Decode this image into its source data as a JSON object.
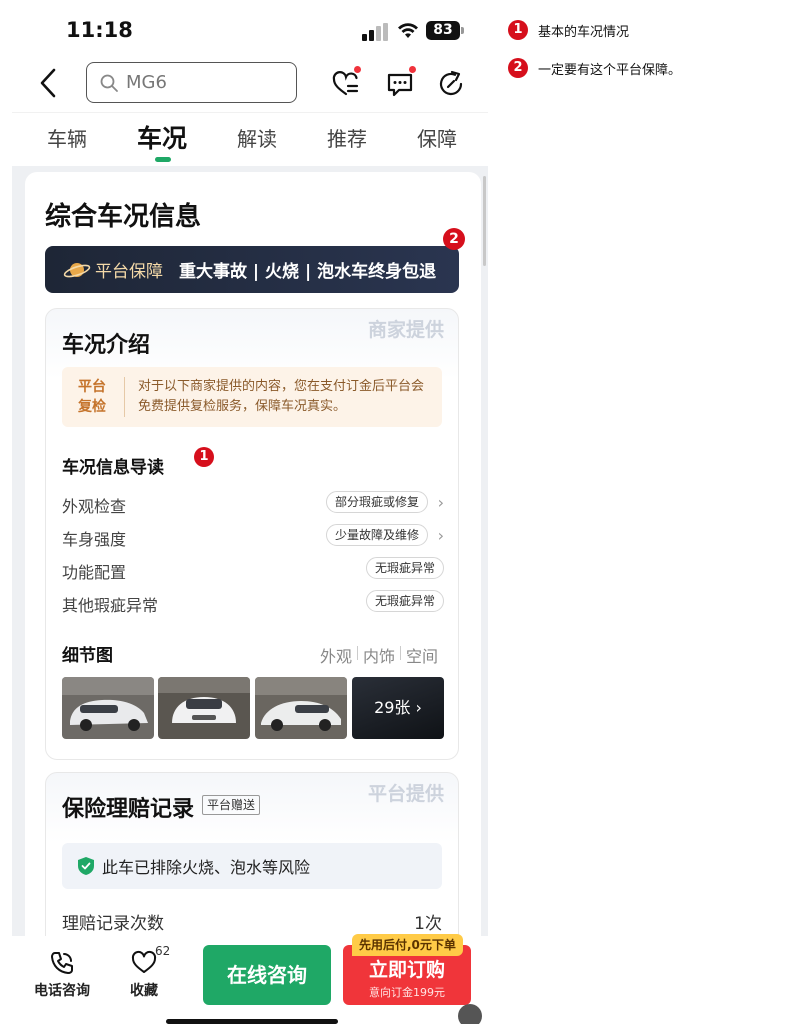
{
  "status_bar": {
    "time": "11:18",
    "battery": "83"
  },
  "nav": {
    "search_value": "MG6"
  },
  "tabs": [
    {
      "label": "车辆"
    },
    {
      "label": "车况",
      "active": true
    },
    {
      "label": "解读"
    },
    {
      "label": "推荐"
    },
    {
      "label": "保障"
    }
  ],
  "main": {
    "title": "综合车况信息",
    "banner": {
      "label": "平台保障",
      "text": "重大事故 | 火烧 | 泡水车终身包退"
    },
    "marker_2": "2",
    "intro": {
      "provider": "商家提供",
      "title": "车况介绍",
      "notice_tag": "平台复检",
      "notice_text": "对于以下商家提供的内容，您在支付订金后平台会免费提供复检服务，保障车况真实。",
      "guide_title": "车况信息导读",
      "marker_1": "1",
      "rows": [
        {
          "label": "外观检查",
          "value": "部分瑕疵或修复",
          "chevron": "›"
        },
        {
          "label": "车身强度",
          "value": "少量故障及维修",
          "chevron": "›"
        },
        {
          "label": "功能配置",
          "value": "无瑕疵异常"
        },
        {
          "label": "其他瑕疵异常",
          "value": "无瑕疵异常"
        }
      ],
      "detail_title": "细节图",
      "detail_tabs": [
        "外观",
        "内饰",
        "空间"
      ],
      "more_photos": "29张 ›"
    },
    "insurance": {
      "provider": "平台提供",
      "title": "保险理赔记录",
      "gift_tag": "平台赠送",
      "safe_text": "此车已排除火烧、泡水等风险",
      "claims_label": "理赔记录次数",
      "claims_value": "1次"
    }
  },
  "bottom": {
    "phone_label": "电话咨询",
    "fav_label": "收藏",
    "fav_count": "62",
    "consult_label": "在线咨询",
    "pay_tag": "先用后付,0元下单",
    "order_label": "立即订购",
    "order_sub": "意向订金199元"
  },
  "annotations": [
    {
      "num": "1",
      "text": "基本的车况情况"
    },
    {
      "num": "2",
      "text": "一定要有这个平台保障。"
    }
  ],
  "colors": {
    "accent_green": "#1fa866",
    "accent_red": "#f0353a",
    "marker_red": "#d60f1c"
  }
}
